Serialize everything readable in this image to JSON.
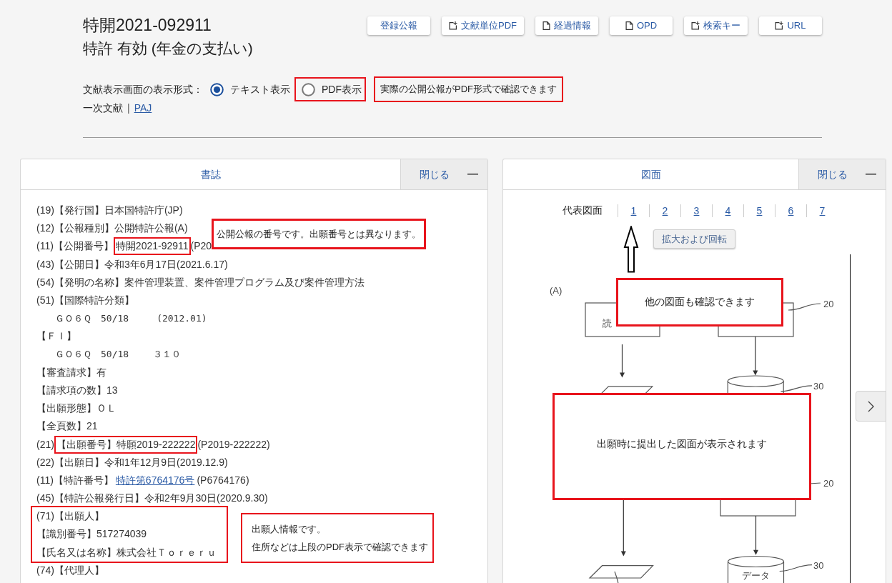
{
  "header": {
    "title": "特開2021-092911",
    "status": "特許 有効 (年金の支払い)"
  },
  "actions": [
    {
      "label": "登録公報",
      "kind": "plain"
    },
    {
      "label": "文献単位PDF",
      "kind": "export"
    },
    {
      "label": "経過情報",
      "kind": "page"
    },
    {
      "label": "OPD",
      "kind": "page"
    },
    {
      "label": "検索キー",
      "kind": "export"
    },
    {
      "label": "URL",
      "kind": "export"
    }
  ],
  "display_format": {
    "label": "文献表示画面の表示形式：",
    "options": [
      {
        "label": "テキスト表示",
        "selected": true,
        "framed": false
      },
      {
        "label": "PDF表示",
        "selected": false,
        "framed": true
      }
    ],
    "note": "実際の公開公報がPDF形式で確認できます"
  },
  "primary_documents": {
    "label": "一次文献",
    "separator": "|",
    "link": "PAJ"
  },
  "bibliography": {
    "title": "書誌",
    "close": "閉じる",
    "items": [
      {
        "kind": "line",
        "parts": [
          {
            "kind": "plain",
            "text": "(19)【発行国】日本国特許庁(JP)"
          }
        ]
      },
      {
        "kind": "line",
        "parts": [
          {
            "kind": "plain",
            "text": "(12)【公報種別】公開特許公報(A)"
          }
        ]
      },
      {
        "kind": "line",
        "parts": [
          {
            "kind": "plain",
            "text": "(11)【公開番号】"
          },
          {
            "kind": "framed",
            "text": "特開2021-92911"
          },
          {
            "kind": "plain",
            "text": "(P20"
          }
        ],
        "note": "公開公報の番号です。出願番号とは異なります。"
      },
      {
        "kind": "line",
        "parts": [
          {
            "kind": "plain",
            "text": "(43)【公開日】令和3年6月17日(2021.6.17)"
          }
        ]
      },
      {
        "kind": "line",
        "parts": [
          {
            "kind": "plain",
            "text": "(54)【発明の名称】案件管理装置、案件管理プログラム及び案件管理方法"
          }
        ]
      },
      {
        "kind": "line",
        "parts": [
          {
            "kind": "plain",
            "text": "(51)【国際特許分類】"
          }
        ],
        "children": [
          {
            "parts": [
              {
                "kind": "plain",
                "text": "ＧＯ６Ｑ　50/18　　　(2012.01)"
              }
            ]
          }
        ]
      },
      {
        "kind": "line",
        "parts": [
          {
            "kind": "plain",
            "text": "【ＦＩ】"
          }
        ],
        "children": [
          {
            "parts": [
              {
                "kind": "plain",
                "text": "ＧＯ６Ｑ　50/18　　 ３１０"
              }
            ]
          }
        ]
      },
      {
        "kind": "line",
        "parts": [
          {
            "kind": "plain",
            "text": "【審査請求】有"
          }
        ]
      },
      {
        "kind": "line",
        "parts": [
          {
            "kind": "plain",
            "text": "【請求項の数】13"
          }
        ]
      },
      {
        "kind": "line",
        "parts": [
          {
            "kind": "plain",
            "text": "【出願形態】ＯＬ"
          }
        ]
      },
      {
        "kind": "line",
        "parts": [
          {
            "kind": "plain",
            "text": "【全頁数】21"
          }
        ]
      },
      {
        "kind": "line",
        "parts": [
          {
            "kind": "plain",
            "text": "(21)"
          },
          {
            "kind": "framed",
            "text": "【出願番号】特願2019-222222"
          },
          {
            "kind": "plain",
            "text": "(P2019-222222)"
          }
        ]
      },
      {
        "kind": "line",
        "parts": [
          {
            "kind": "plain",
            "text": "(22)【出願日】令和1年12月9日(2019.12.9)"
          }
        ]
      },
      {
        "kind": "line",
        "parts": [
          {
            "kind": "plain",
            "text": "(11)【特許番号】"
          },
          {
            "kind": "link",
            "text": "特許第6764176号"
          },
          {
            "kind": "plain",
            "text": "(P6764176)"
          }
        ]
      },
      {
        "kind": "line",
        "parts": [
          {
            "kind": "plain",
            "text": "(45)【特許公報発行日】令和2年9月30日(2020.9.30)"
          }
        ]
      },
      {
        "kind": "group",
        "lines": [
          {
            "parts": [
              {
                "kind": "plain",
                "text": "(71)【出願人】"
              }
            ]
          },
          {
            "parts": [
              {
                "kind": "plain",
                "text": "【識別番号】517274039"
              }
            ]
          },
          {
            "parts": [
              {
                "kind": "plain",
                "text": "【氏名又は名称】株式会社Ｔｏｒｅｒｕ"
              }
            ]
          }
        ],
        "note": [
          "出願人情報です。",
          "住所などは上段のPDF表示で確認できます"
        ]
      },
      {
        "kind": "line",
        "parts": [
          {
            "kind": "plain",
            "text": "(74)【代理人】"
          }
        ]
      }
    ]
  },
  "drawings": {
    "title": "図面",
    "close": "閉じる",
    "representative": "代表図面",
    "pages": [
      "1",
      "2",
      "3",
      "4",
      "5",
      "6",
      "7"
    ],
    "zoom_button": "拡大および回転",
    "notes": [
      "他の図面も確認できます",
      "出願時に提出した図面が表示されます"
    ],
    "figure": {
      "caption": "(A)",
      "box_text": "読",
      "refs": [
        "20",
        "30",
        "20",
        "30"
      ],
      "cylinder_text": "データ"
    }
  }
}
